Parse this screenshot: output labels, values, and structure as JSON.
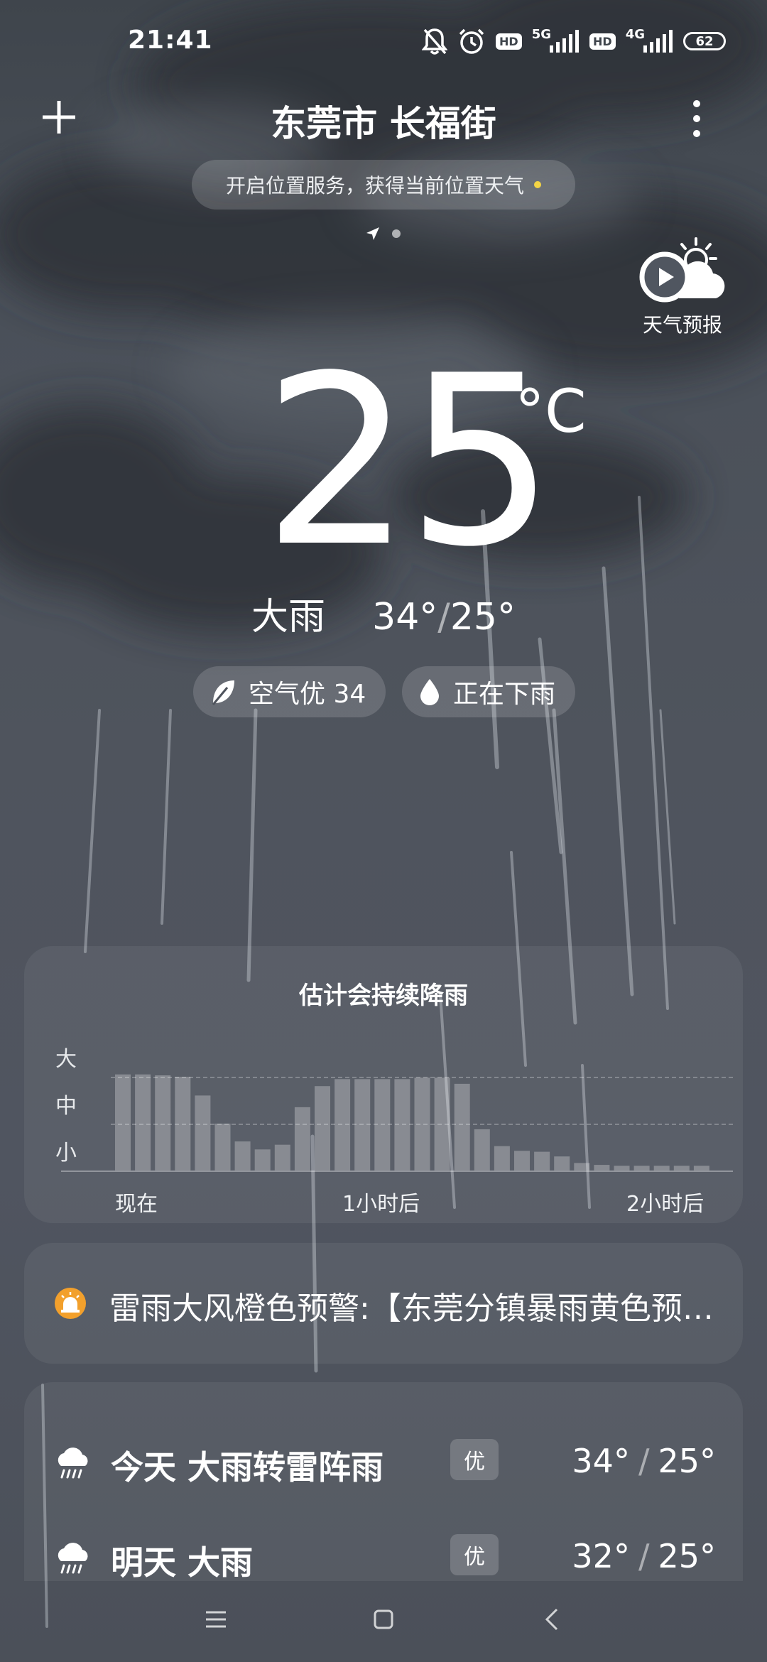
{
  "status_bar": {
    "time": "21:41",
    "hd_1": "HD",
    "net_1": "5G",
    "hd_2": "HD",
    "net_2": "4G",
    "battery": "62"
  },
  "header": {
    "city": "东莞市 长福街",
    "location_prompt": "开启位置服务，获得当前位置天气"
  },
  "forecast_video": {
    "label": "天气预报"
  },
  "current": {
    "temperature": "25",
    "unit": "°C",
    "condition": "大雨",
    "high": "34°",
    "low": "25°",
    "air_quality": "空气优 34",
    "rain_status": "正在下雨"
  },
  "precip_card": {
    "title": "估计会持续降雨",
    "y_labels": [
      "大",
      "中",
      "小"
    ],
    "x_labels": [
      "现在",
      "1小时后",
      "2小时后"
    ]
  },
  "chart_data": {
    "type": "bar",
    "title": "估计会持续降雨",
    "x_ticks": [
      "现在",
      "1小时后",
      "2小时后"
    ],
    "y_categories": [
      "小",
      "中",
      "大"
    ],
    "ylim": [
      0,
      3
    ],
    "values": [
      2.05,
      2.05,
      2.03,
      2.0,
      1.6,
      1.0,
      0.62,
      0.45,
      0.55,
      1.35,
      1.8,
      1.95,
      1.95,
      1.95,
      1.95,
      1.98,
      1.98,
      1.85,
      0.88,
      0.52,
      0.42,
      0.4,
      0.3,
      0.16,
      0.12,
      0.1,
      0.1,
      0.1,
      0.1,
      0.1
    ]
  },
  "alert": {
    "text": "雷雨大风橙色预警:【东莞分镇暴雨黄色预警信号】"
  },
  "daily": [
    {
      "label": "今天  大雨转雷阵雨",
      "aqi": "优",
      "high": "34°",
      "low": "25°",
      "icon": "heavy-rain-icon"
    },
    {
      "label": "明天  大雨",
      "aqi": "优",
      "high": "32°",
      "low": "25°",
      "icon": "heavy-rain-icon"
    }
  ],
  "colors": {
    "accent_dot": "#f3d445",
    "alert_orange": "#f2a02c"
  }
}
